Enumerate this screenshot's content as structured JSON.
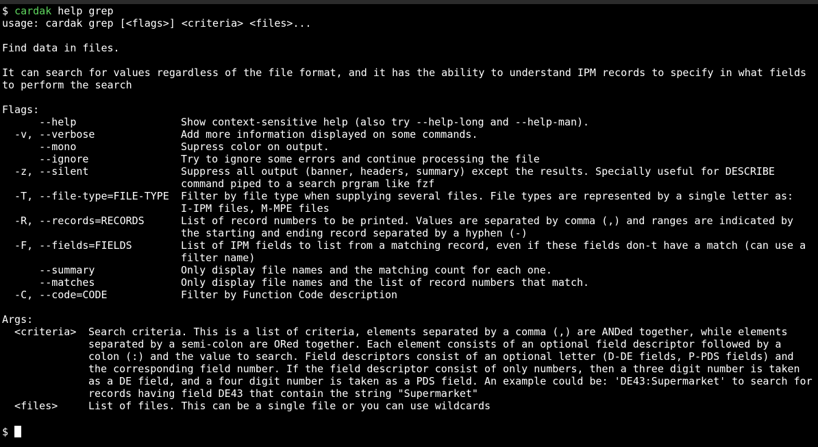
{
  "prompt": {
    "symbol": "$",
    "command": "cardak",
    "args": "help grep"
  },
  "usage": "usage: cardak grep [<flags>] <criteria> <files>...",
  "summary": "Find data in files.",
  "description": [
    "It can search for values regardless of the file format, and it has the ability to understand IPM records to specify in what fields",
    "to perform the search"
  ],
  "flags_title": "Flags:",
  "flags": [
    {
      "flag": "      --help",
      "desc": [
        "Show context-sensitive help (also try --help-long and --help-man)."
      ]
    },
    {
      "flag": "  -v, --verbose",
      "desc": [
        "Add more information displayed on some commands."
      ]
    },
    {
      "flag": "      --mono",
      "desc": [
        "Supress color on output."
      ]
    },
    {
      "flag": "      --ignore",
      "desc": [
        "Try to ignore some errors and continue processing the file"
      ]
    },
    {
      "flag": "  -z, --silent",
      "desc": [
        "Suppress all output (banner, headers, summary) except the results. Specially useful for DESCRIBE",
        "command piped to a search prgram like fzf"
      ]
    },
    {
      "flag": "  -T, --file-type=FILE-TYPE",
      "desc": [
        "Filter by file type when supplying several files. File types are represented by a single letter as:",
        "I-IPM files, M-MPE files"
      ]
    },
    {
      "flag": "  -R, --records=RECORDS",
      "desc": [
        "List of record numbers to be printed. Values are separated by comma (,) and ranges are indicated by",
        "the starting and ending record separated by a hyphen (-)"
      ]
    },
    {
      "flag": "  -F, --fields=FIELDS",
      "desc": [
        "List of IPM fields to list from a matching record, even if these fields don-t have a match (can use a",
        "filter name)"
      ]
    },
    {
      "flag": "      --summary",
      "desc": [
        "Only display file names and the matching count for each one."
      ]
    },
    {
      "flag": "      --matches",
      "desc": [
        "Only display file names and the list of record numbers that match."
      ]
    },
    {
      "flag": "  -C, --code=CODE",
      "desc": [
        "Filter by Function Code description"
      ]
    }
  ],
  "args_title": "Args:",
  "args": [
    {
      "arg": "  <criteria>",
      "desc": [
        "Search criteria. This is a list of criteria, elements separated by a comma (,) are ANDed together, while elements",
        "separated by a semi-colon are ORed together. Each element consists of an optional field descriptor followed by a",
        "colon (:) and the value to search. Field descriptors consist of an optional letter (D-DE fields, P-PDS fields) and",
        "the corresponding field number. If the field descriptor consist of only numbers, then a three digit number is taken",
        "as a DE field, and a four digit number is taken as a PDS field. An example could be: 'DE43:Supermarket' to search for",
        "records having field DE43 that contain the string \"Supermarket\""
      ]
    },
    {
      "arg": "  <files>",
      "desc": [
        "List of files. This can be a single file or you can use wildcards"
      ]
    }
  ],
  "final_prompt": "$",
  "colors": {
    "background": "#000000",
    "text": "#ffffff",
    "command": "#5fd75f",
    "topbar": "#2b2b2b"
  }
}
